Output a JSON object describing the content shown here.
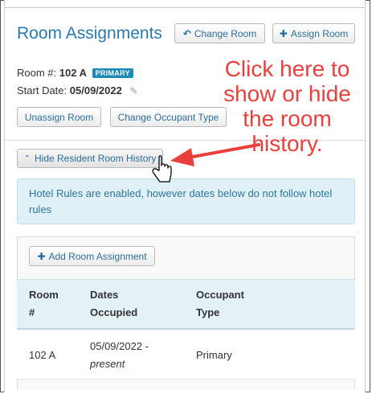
{
  "panel": {
    "title": "Room Assignments",
    "change_room_label": "Change Room",
    "assign_room_label": "Assign Room"
  },
  "room": {
    "room_label": "Room #:",
    "room_number": "102 A",
    "badge": "PRIMARY",
    "start_label": "Start Date:",
    "start_date": "05/09/2022"
  },
  "actions": {
    "unassign_label": "Unassign Room",
    "change_occupant_label": "Change Occupant Type",
    "hide_history_label": "Hide Resident Room History"
  },
  "alert": {
    "text": "Hotel Rules are enabled, however dates below do not follow hotel rules"
  },
  "history": {
    "add_label": "Add Room Assignment",
    "columns": [
      "Room #",
      "Dates Occupied",
      "Occupant Type"
    ],
    "rows": [
      {
        "room": "102 A",
        "date_start": "05/09/2022 -",
        "date_end": "present",
        "type": "Primary"
      }
    ]
  },
  "annotation": {
    "text": "Click here to show or hide the room history."
  },
  "colors": {
    "accent": "#2a7ab0",
    "annotation": "#e8403d",
    "alert_bg": "#dff0f6",
    "badge": "#1c8ab6"
  }
}
